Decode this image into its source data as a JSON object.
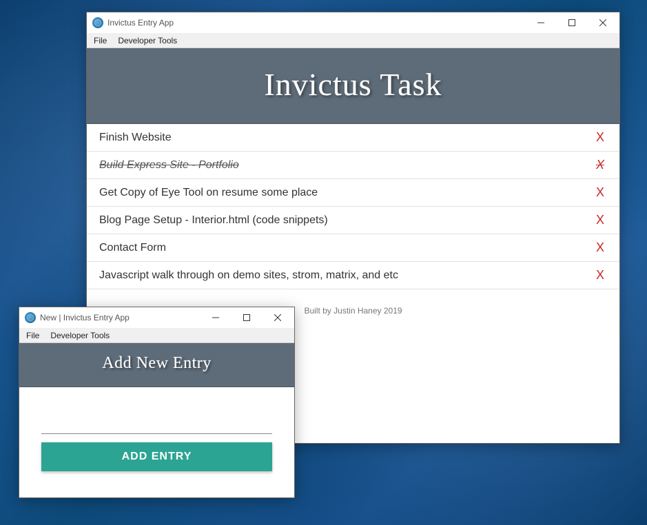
{
  "main_window": {
    "title": "Invictus Entry App",
    "menubar": {
      "file": "File",
      "devtools": "Developer Tools"
    },
    "header_title": "Invictus Task",
    "tasks": [
      {
        "text": "Finish Website",
        "done": false
      },
      {
        "text": "Build Express Site - Portfolio",
        "done": true
      },
      {
        "text": "Get Copy of Eye Tool on resume some place",
        "done": false
      },
      {
        "text": "Blog Page Setup - Interior.html (code snippets)",
        "done": false
      },
      {
        "text": "Contact Form",
        "done": false
      },
      {
        "text": "Javascript walk through on demo sites, strom, matrix, and etc",
        "done": false
      }
    ],
    "delete_label": "X",
    "footer": "Built by Justin Haney 2019"
  },
  "dialog_window": {
    "title": "New | Invictus Entry App",
    "menubar": {
      "file": "File",
      "devtools": "Developer Tools"
    },
    "header_title": "Add New Entry",
    "input_value": "",
    "add_button_label": "ADD ENTRY"
  }
}
